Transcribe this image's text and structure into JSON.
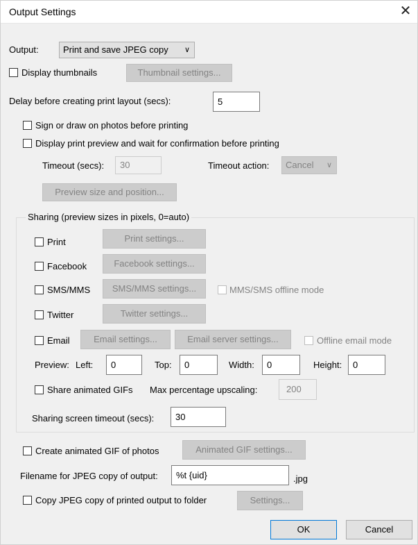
{
  "window": {
    "title": "Output Settings",
    "close_glyph": "✕"
  },
  "output": {
    "label": "Output:",
    "selected": "Print and save JPEG copy",
    "chevron": "∨"
  },
  "thumbnails": {
    "label": "Display thumbnails",
    "button": "Thumbnail settings..."
  },
  "delay": {
    "label": "Delay before creating print layout (secs):",
    "value": "5"
  },
  "sign_draw": {
    "label": "Sign or draw on photos before printing"
  },
  "print_preview": {
    "label": "Display print preview and wait for confirmation before printing"
  },
  "timeout": {
    "label": "Timeout (secs):",
    "value": "30",
    "action_label": "Timeout action:",
    "action_value": "Cancel"
  },
  "preview_size_button": "Preview size and position...",
  "sharing": {
    "group_label": "Sharing (preview sizes in pixels, 0=auto)",
    "print": {
      "label": "Print",
      "button": "Print settings..."
    },
    "facebook": {
      "label": "Facebook",
      "button": "Facebook settings..."
    },
    "sms": {
      "label": "SMS/MMS",
      "button": "SMS/MMS settings...",
      "offline_label": "MMS/SMS offline mode"
    },
    "twitter": {
      "label": "Twitter",
      "button": "Twitter settings..."
    },
    "email": {
      "label": "Email",
      "button": "Email settings...",
      "server_button": "Email server settings...",
      "offline_label": "Offline email mode"
    },
    "preview": {
      "label": "Preview:",
      "left_label": "Left:",
      "left_value": "0",
      "top_label": "Top:",
      "top_value": "0",
      "width_label": "Width:",
      "width_value": "0",
      "height_label": "Height:",
      "height_value": "0"
    },
    "animated_gifs": {
      "label": "Share animated GIFs",
      "upscale_label": "Max percentage upscaling:",
      "upscale_value": "200"
    },
    "screen_timeout": {
      "label": "Sharing screen timeout (secs):",
      "value": "30"
    }
  },
  "animated_gif": {
    "label": "Create animated GIF of photos",
    "button": "Animated GIF settings..."
  },
  "filename": {
    "label": "Filename for JPEG copy of output:",
    "value": "%t {uid}",
    "suffix": ".jpg"
  },
  "copy_folder": {
    "label": "Copy JPEG copy of printed output to folder",
    "button": "Settings..."
  },
  "footer": {
    "ok": "OK",
    "cancel": "Cancel"
  }
}
